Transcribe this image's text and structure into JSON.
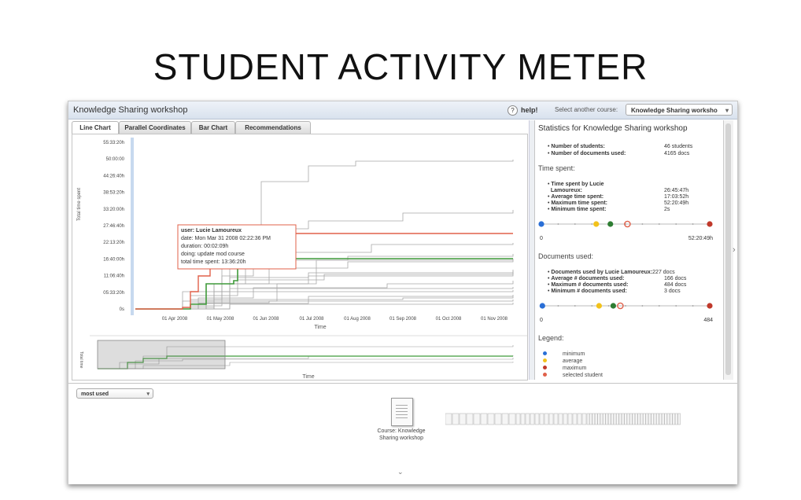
{
  "slide": {
    "title": "STUDENT ACTIVITY METER"
  },
  "app": {
    "title": "Knowledge Sharing workshop",
    "help": "help!",
    "select_label": "Select another course:",
    "selected_course": "Knowledge Sharing worksho"
  },
  "tabs": [
    "Line Chart",
    "Parallel Coordinates",
    "Bar Chart",
    "Recommendations"
  ],
  "chart": {
    "y_axis_label": "Total time spent",
    "y_ticks": [
      "55:33:20h",
      "50:00:00",
      "44:26:40h",
      "38:53:20h",
      "33:20:00h",
      "27:46:40h",
      "22:13:20h",
      "16:40:00h",
      "11:06:40h",
      "05:33:20h",
      "0s"
    ],
    "x_ticks": [
      "01 Apr 2008",
      "01 May 2008",
      "01 Jun 2008",
      "01 Jul 2008",
      "01 Aug 2008",
      "01 Sep 2008",
      "01 Oct 2008",
      "01 Nov 2008"
    ],
    "x_label": "Time",
    "mini_y_label": "Total time",
    "mini_x_label": "Time",
    "tooltip": {
      "user": "user: Lucie Lamoureux",
      "date": "date: Mon Mar 31 2008 02:22:36 PM",
      "duration": "duration: 00:02:09h",
      "doing": "doing: update mod course",
      "total": "total time spent: 13:36:20h"
    }
  },
  "stats": {
    "title": "Statistics for Knowledge Sharing workshop",
    "num_students_label": "Number of students:",
    "num_students_value": "46 students",
    "num_docs_label": "Number of documents used:",
    "num_docs_value": "4165 docs",
    "time_section": "Time spent:",
    "time_by_label_1": "Time spent by Lucie",
    "time_by_label_2": "Lamoureux:",
    "time_by_value": "26:45:47h",
    "avg_time_label": "Average time spent:",
    "avg_time_value": "17:03:52h",
    "max_time_label": "Maximum time spent:",
    "max_time_value": "52:20:49h",
    "min_time_label": "Minimum time spent:",
    "min_time_value": "2s",
    "time_scale_min": "0",
    "time_scale_max": "52:20:49h",
    "docs_section": "Documents used:",
    "docs_by_label": "Documents used by Lucie Lamoureux:",
    "docs_by_value": "227 docs",
    "avg_docs_label": "Average # documents used:",
    "avg_docs_value": "166 docs",
    "max_docs_label": "Maximum # documents used:",
    "max_docs_value": "484 docs",
    "min_docs_label": "Minimum # documents used:",
    "min_docs_value": "3 docs",
    "docs_scale_min": "0",
    "docs_scale_max": "484",
    "legend_title": "Legend:",
    "legend": [
      {
        "label": "minimum",
        "color": "#2a6fd6"
      },
      {
        "label": "average",
        "color": "#f2c21b"
      },
      {
        "label": "maximum",
        "color": "#c0392b"
      },
      {
        "label": "selected student",
        "color": "#e0604a"
      }
    ],
    "time_markers": {
      "min": 0,
      "average": 17.06,
      "selected": 26.76,
      "max": 52.35,
      "scale_max": 52.35
    },
    "docs_markers": {
      "min": 3,
      "average": 166,
      "selected": 227,
      "max": 484,
      "scale_max": 484
    }
  },
  "bottom": {
    "dropdown": "most used",
    "course_caption_1": "Course: Knowledge",
    "course_caption_2": "Sharing workshop"
  },
  "colors": {
    "selected_line": "#e0604a",
    "average_line": "#3f9a3a",
    "other_lines": "#a8a8a8"
  }
}
